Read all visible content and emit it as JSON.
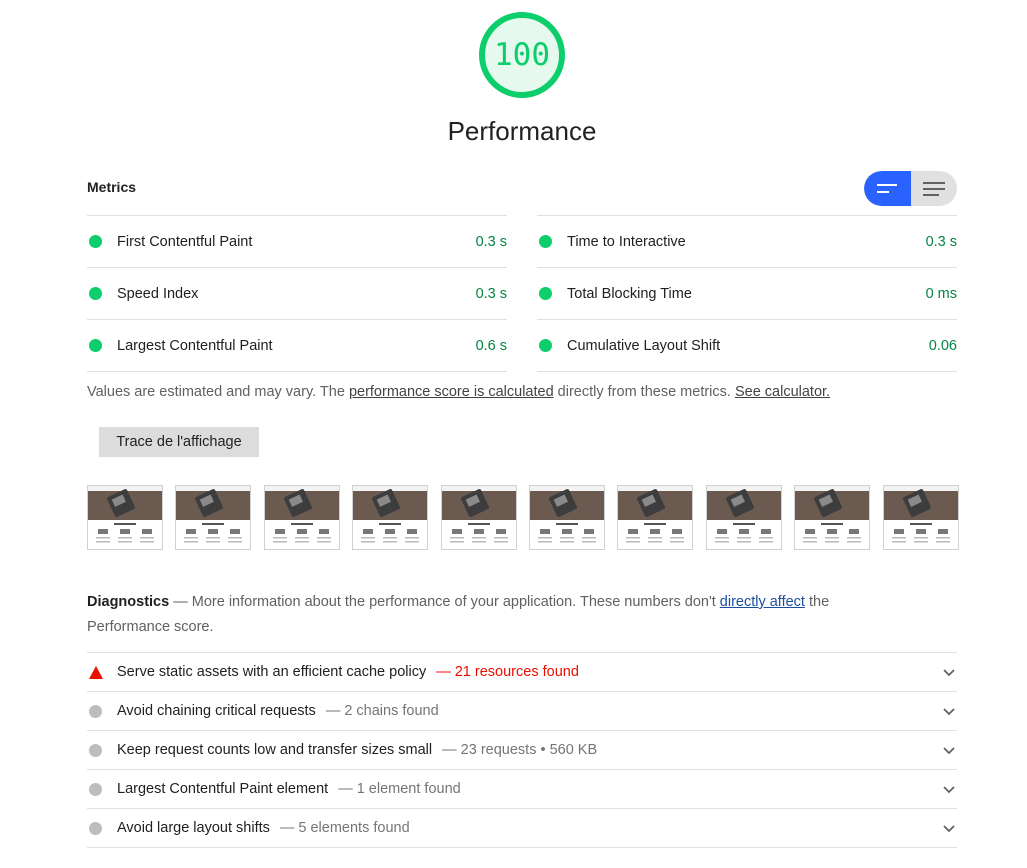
{
  "gauge": {
    "score": "100",
    "color": "#0cce6b"
  },
  "category_title": "Performance",
  "metrics": {
    "heading": "Metrics",
    "left": [
      {
        "label": "First Contentful Paint",
        "value": "0.3 s",
        "status": "pass"
      },
      {
        "label": "Speed Index",
        "value": "0.3 s",
        "status": "pass"
      },
      {
        "label": "Largest Contentful Paint",
        "value": "0.6 s",
        "status": "pass"
      }
    ],
    "right": [
      {
        "label": "Time to Interactive",
        "value": "0.3 s",
        "status": "pass"
      },
      {
        "label": "Total Blocking Time",
        "value": "0 ms",
        "status": "pass"
      },
      {
        "label": "Cumulative Layout Shift",
        "value": "0.06",
        "status": "pass"
      }
    ],
    "toggle": {
      "selected": "compact-view",
      "options": [
        "compact-view-icon",
        "expanded-view-icon"
      ]
    }
  },
  "note": {
    "prefix": "Values are estimated and may vary. The ",
    "link1": "performance score is calculated",
    "middle": " directly from these metrics. ",
    "link2": "See calculator."
  },
  "trace_button": "Trace de l'affichage",
  "filmstrip_frames": 10,
  "diagnostics": {
    "title": "Diagnostics",
    "dash": " — ",
    "text1": "More information about the performance of your application. These numbers don't ",
    "link": "directly affect",
    "text2": " the Performance score."
  },
  "audits": [
    {
      "title": "Serve static assets with an efficient cache policy",
      "detail": "— 21 resources found",
      "status": "fail"
    },
    {
      "title": "Avoid chaining critical requests",
      "detail": "— 2 chains found",
      "status": "info"
    },
    {
      "title": "Keep request counts low and transfer sizes small",
      "detail": "— 23 requests • 560 KB",
      "status": "info"
    },
    {
      "title": "Largest Contentful Paint element",
      "detail": "— 1 element found",
      "status": "info"
    },
    {
      "title": "Avoid large layout shifts",
      "detail": "— 5 elements found",
      "status": "info"
    }
  ],
  "colors": {
    "pass": "#0cce6b",
    "fail": "#eb0f00",
    "info": "#bdbdbd",
    "accent": "#2962ff"
  }
}
